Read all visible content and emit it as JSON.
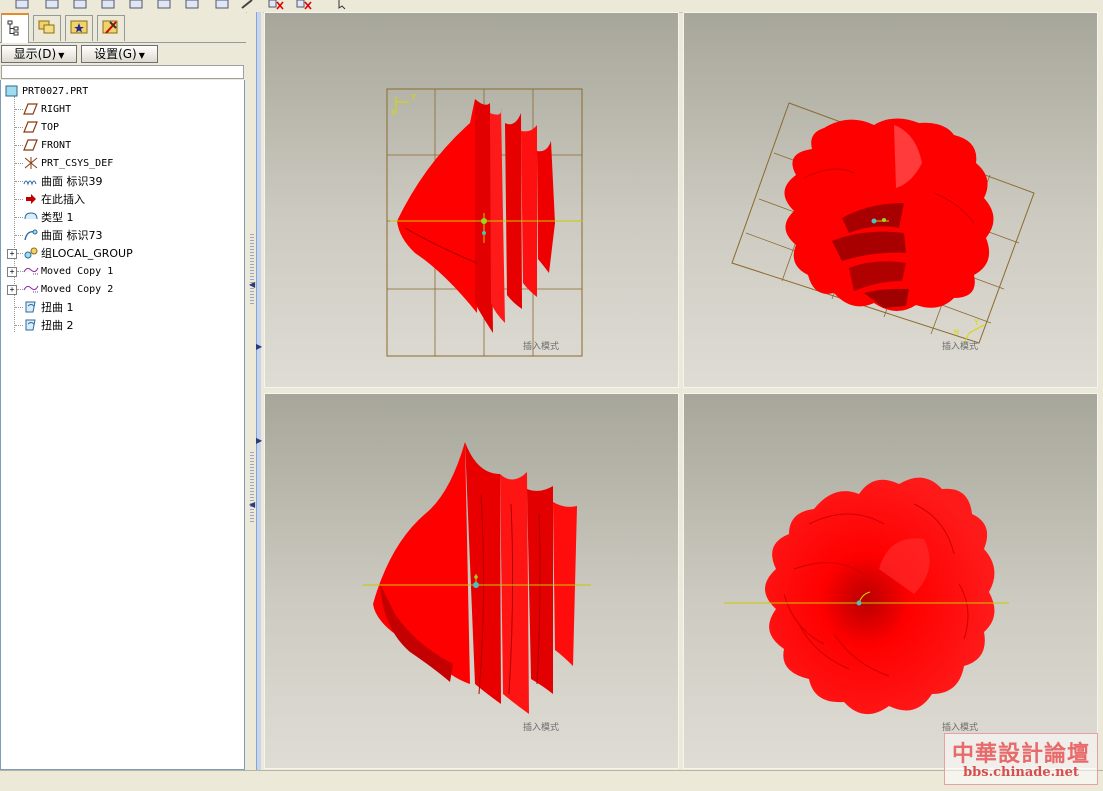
{
  "menu": {
    "display_label": "显示(D)",
    "settings_label": "设置(G)"
  },
  "model_tree": {
    "items": [
      {
        "label": "PRT0027.PRT",
        "icon": "part-icon"
      },
      {
        "label": "RIGHT",
        "icon": "datum-plane-icon"
      },
      {
        "label": "TOP",
        "icon": "datum-plane-icon"
      },
      {
        "label": "FRONT",
        "icon": "datum-plane-icon"
      },
      {
        "label": "PRT_CSYS_DEF",
        "icon": "coordinate-system-icon"
      },
      {
        "label": "曲面 标识39",
        "icon": "surface-icon"
      },
      {
        "label": "在此插入",
        "icon": "insert-here-arrow-icon"
      },
      {
        "label": "类型 1",
        "icon": "type-feature-icon"
      },
      {
        "label": "曲面 标识73",
        "icon": "surface-icon"
      },
      {
        "label": "组LOCAL_GROUP",
        "icon": "group-icon"
      },
      {
        "label": "Moved Copy 1",
        "icon": "moved-copy-icon"
      },
      {
        "label": "Moved Copy 2",
        "icon": "moved-copy-icon"
      },
      {
        "label": "扭曲 1",
        "icon": "warp-icon"
      },
      {
        "label": "扭曲 2",
        "icon": "warp-icon"
      }
    ]
  },
  "viewports": [
    {
      "name": "front",
      "label": "插入模式",
      "axis": "Y H"
    },
    {
      "name": "top",
      "label": "插入模式",
      "axis": "H Y"
    },
    {
      "name": "side",
      "label": "插入模式"
    },
    {
      "name": "iso",
      "label": "插入模式"
    }
  ],
  "colors": {
    "flower_red": "#ff0000",
    "datum_grid": "#8b6a2e",
    "axis_yellow": "#d8d800"
  },
  "watermark": {
    "title": "中華設計論壇",
    "url": "bbs.chinade.net"
  }
}
